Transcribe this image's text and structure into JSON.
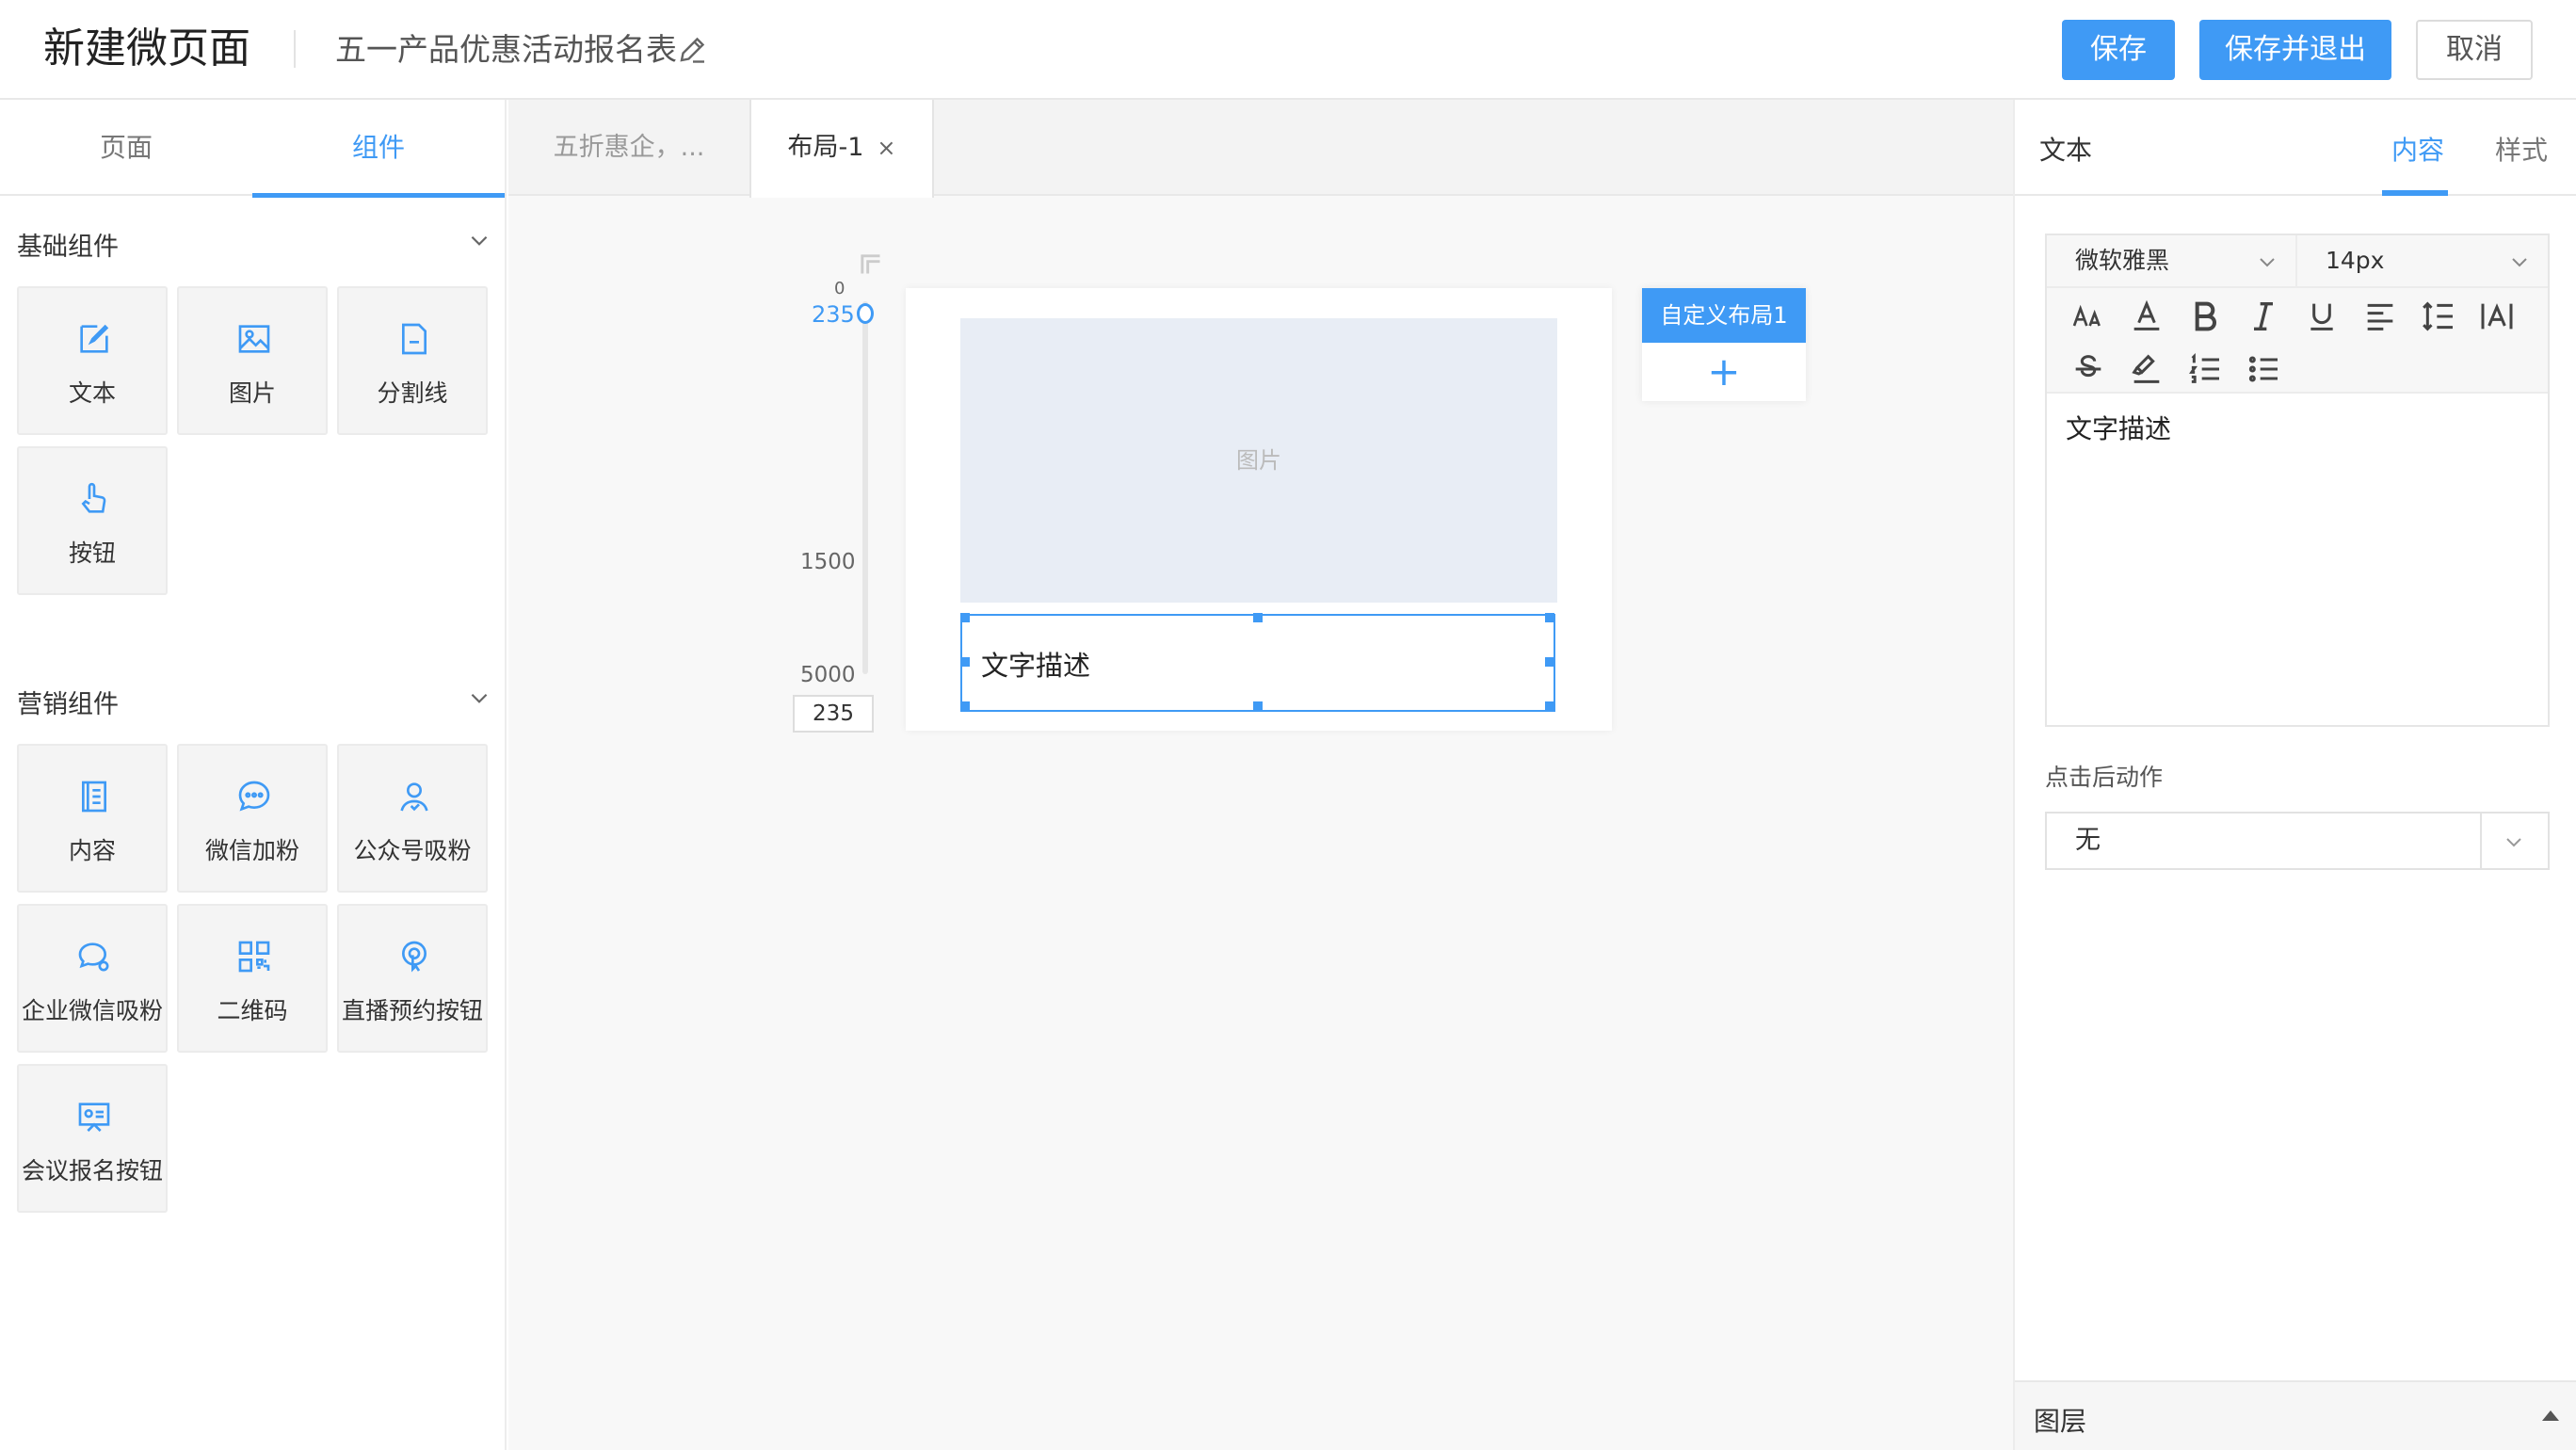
{
  "header": {
    "app_title": "新建微页面",
    "doc_title": "五一产品优惠活动报名表",
    "buttons": {
      "save": "保存",
      "save_exit": "保存并退出",
      "cancel": "取消"
    }
  },
  "left": {
    "tabs": [
      "页面",
      "组件"
    ],
    "active_tab": "组件",
    "sections": [
      {
        "title": "基础组件",
        "items": [
          {
            "label": "文本",
            "icon": "edit-icon"
          },
          {
            "label": "图片",
            "icon": "image-icon"
          },
          {
            "label": "分割线",
            "icon": "divider-file-icon"
          },
          {
            "label": "按钮",
            "icon": "pointer-hand-icon"
          }
        ]
      },
      {
        "title": "营销组件",
        "items": [
          {
            "label": "内容",
            "icon": "content-book-icon"
          },
          {
            "label": "微信加粉",
            "icon": "wechat-chat-icon"
          },
          {
            "label": "公众号吸粉",
            "icon": "user-follow-icon"
          },
          {
            "label": "企业微信吸粉",
            "icon": "enterprise-chat-icon"
          },
          {
            "label": "二维码",
            "icon": "qrcode-icon"
          },
          {
            "label": "直播预约按钮",
            "icon": "live-touch-icon"
          },
          {
            "label": "会议报名按钮",
            "icon": "meeting-board-icon"
          }
        ]
      }
    ]
  },
  "middle": {
    "tabs": [
      {
        "label": "五折惠企，...",
        "active": false
      },
      {
        "label": "布局-1",
        "active": true,
        "close": "×"
      }
    ],
    "slider": {
      "value": "235",
      "ticks": [
        "0",
        "1500",
        "5000"
      ],
      "input_value": "235"
    },
    "canvas": {
      "image_placeholder": "图片",
      "text_block": "文字描述"
    },
    "layout": {
      "label": "自定义布局1",
      "add": "+"
    }
  },
  "right": {
    "title": "文本",
    "tabs": [
      "内容",
      "样式"
    ],
    "active_tab": "内容",
    "font_family": "微软雅黑",
    "font_size": "14px",
    "toolbar_icons": [
      "font-size-icon",
      "font-color-icon",
      "bold-icon",
      "italic-icon",
      "underline-icon",
      "align-icon",
      "line-height-icon",
      "letter-spacing-icon",
      "strikethrough-icon",
      "highlight-icon",
      "ordered-list-icon",
      "unordered-list-icon"
    ],
    "editor_text": "文字描述",
    "action_label": "点击后动作",
    "action_value": "无",
    "layers_label": "图层"
  },
  "colors": {
    "accent": "#3f9af5",
    "image_placeholder_bg": "#e8edf5"
  }
}
